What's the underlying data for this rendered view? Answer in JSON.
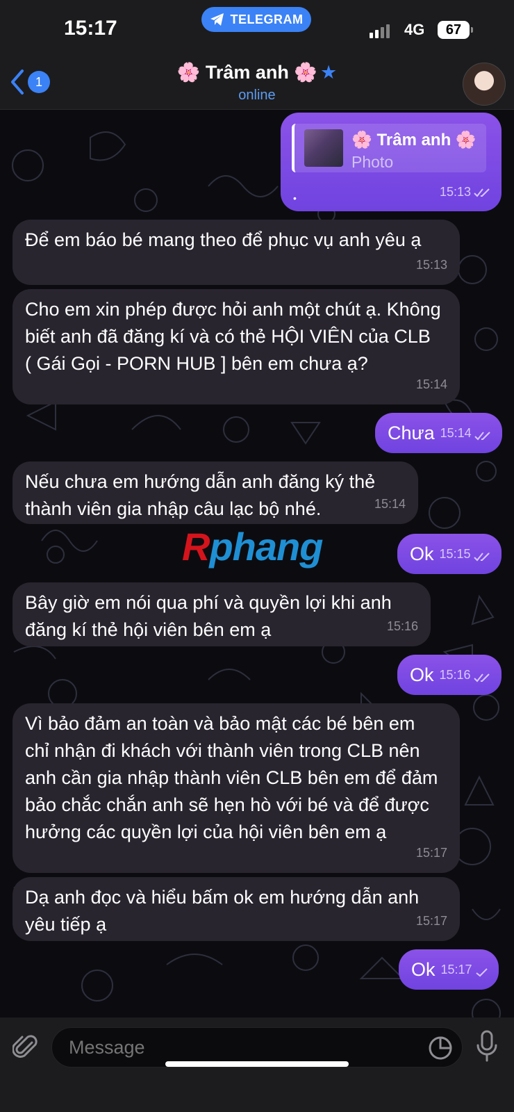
{
  "status": {
    "time": "15:17",
    "app_pill": "TELEGRAM",
    "network": "4G",
    "battery": "67"
  },
  "header": {
    "back_badge": "1",
    "title": "🌸 Trâm anh 🌸",
    "subtitle": "online"
  },
  "watermark": {
    "r": "R",
    "rest": "phang"
  },
  "reply_preview": {
    "name": "🌸 Trâm anh 🌸",
    "sub": "Photo",
    "dot": "•",
    "time": "15:13"
  },
  "messages": [
    {
      "dir": "in",
      "text": "Để em báo bé mang  theo để phục vụ anh yêu ạ",
      "time": "15:13"
    },
    {
      "dir": "in",
      "text": "Cho em xin phép được hỏi anh một chút ạ. Không biết anh đã đăng kí và có thẻ HỘI VIÊN của CLB ( Gái Gọi - PORN HUB ] bên em chưa ạ?",
      "time": "15:14"
    },
    {
      "dir": "out",
      "text": "Chưa",
      "time": "15:14"
    },
    {
      "dir": "in",
      "text": "Nếu chưa em hướng dẫn anh đăng ký thẻ thành viên gia nhập câu lạc bộ nhé.",
      "time": "15:14"
    },
    {
      "dir": "out",
      "text": "Ok",
      "time": "15:15"
    },
    {
      "dir": "in",
      "text": "Bây giờ em nói qua phí và quyền lợi khi anh đăng kí thẻ hội viên bên em ạ",
      "time": "15:16"
    },
    {
      "dir": "out",
      "text": "Ok",
      "time": "15:16"
    },
    {
      "dir": "in",
      "text": "Vì bảo đảm an toàn và bảo mật các bé bên em chỉ nhận đi khách với thành viên trong CLB nên  anh cần gia nhập thành viên CLB bên em để đảm bảo chắc chắn anh sẽ hẹn hò với bé và để được hưởng các quyền lợi của hội viên bên em ạ",
      "time": "15:17"
    },
    {
      "dir": "in",
      "text": "Dạ anh đọc và hiểu bấm ok em hướng dẫn anh yêu tiếp ạ",
      "time": "15:17"
    },
    {
      "dir": "out",
      "text": "Ok",
      "time": "15:17"
    }
  ],
  "composer": {
    "placeholder": "Message"
  },
  "colors": {
    "accent": "#3b82f6",
    "outgoing": "#7c4ae6",
    "incoming": "#29252f"
  },
  "icons": [
    "back-chevron-icon",
    "telegram-icon",
    "star-icon",
    "attach-icon",
    "sticker-icon",
    "mic-icon",
    "double-check-icon",
    "single-check-icon"
  ]
}
